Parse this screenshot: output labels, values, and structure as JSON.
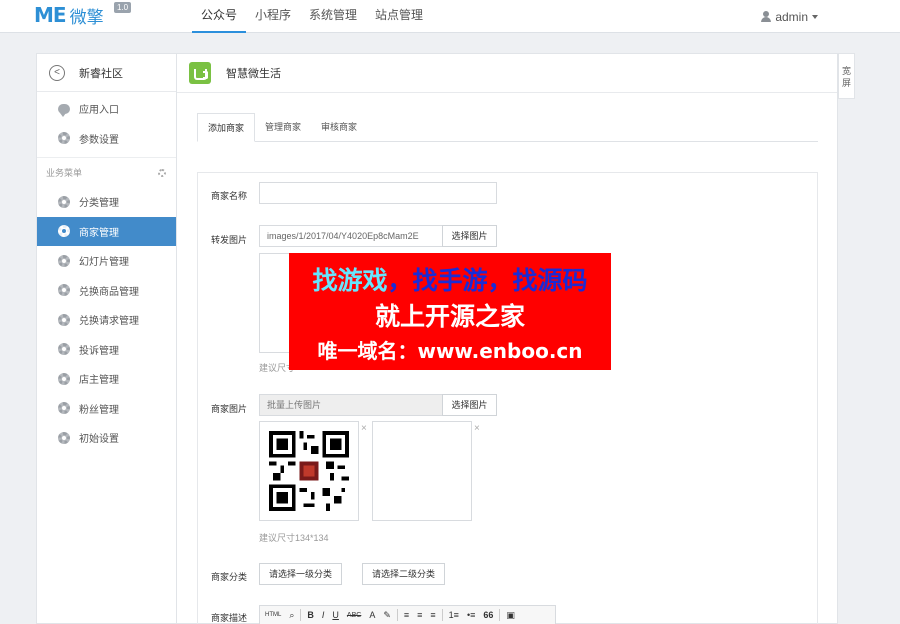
{
  "brand": {
    "logo_mark": "ME",
    "logo_text": "微擎",
    "version": "1.0"
  },
  "topnav": [
    {
      "label": "公众号",
      "active": true
    },
    {
      "label": "小程序"
    },
    {
      "label": "系统管理"
    },
    {
      "label": "站点管理"
    }
  ],
  "user": {
    "name": "admin"
  },
  "sidebar": {
    "back_title": "新睿社区",
    "top_items": [
      {
        "label": "应用入口",
        "icon": "chat-icon"
      },
      {
        "label": "参数设置",
        "icon": "gear-icon"
      }
    ],
    "section_label": "业务菜单",
    "items": [
      {
        "label": "分类管理"
      },
      {
        "label": "商家管理",
        "active": true
      },
      {
        "label": "幻灯片管理"
      },
      {
        "label": "兑换商品管理"
      },
      {
        "label": "兑换请求管理"
      },
      {
        "label": "投诉管理"
      },
      {
        "label": "店主管理"
      },
      {
        "label": "粉丝管理"
      },
      {
        "label": "初始设置"
      }
    ]
  },
  "main": {
    "title": "智慧微生活",
    "tabs": [
      {
        "label": "添加商家",
        "active": true
      },
      {
        "label": "管理商家"
      },
      {
        "label": "审核商家"
      }
    ],
    "form": {
      "name_label": "商家名称",
      "name_value": "",
      "cover_label": "转发图片",
      "cover_value": "images/1/2017/04/Y4020Ep8cMam2E",
      "select_image_button": "选择图片",
      "cover_hint": "建议尺寸",
      "images_label": "商家图片",
      "images_placeholder": "批量上传图片",
      "images_hint": "建议尺寸134*134",
      "category_label": "商家分类",
      "category_level1": "请选择一级分类",
      "category_level2": "请选择二级分类",
      "desc_label": "商家描述"
    },
    "editor_toolbar": [
      "HTML",
      "B",
      "I",
      "U",
      "ABC",
      "A",
      "≡",
      "≡",
      "≡",
      "1≡",
      "•≡",
      "66"
    ]
  },
  "banner": {
    "line1_part1": "找游戏",
    "line1_part2": "，找手游，找源码",
    "line2": "就上开源之家",
    "line3": "唯一域名：www.enboo.cn"
  },
  "wide_toggle": "宽屏",
  "colors": {
    "accent": "#428bca",
    "banner_bg": "#ff0000",
    "app_icon": "#7ac143"
  }
}
